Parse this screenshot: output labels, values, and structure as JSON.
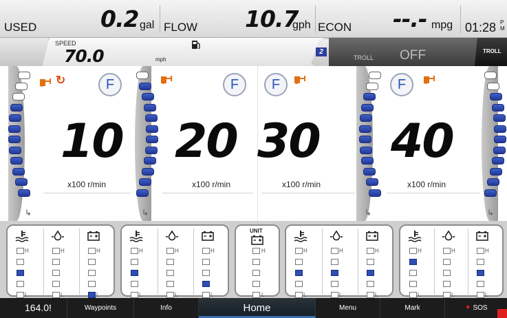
{
  "topbar": {
    "used_label": "USED",
    "used_value": "0.2",
    "used_unit": "gal",
    "flow_label": "FLOW",
    "flow_value": "10.7",
    "flow_unit": "gph",
    "econ_label": "ECON",
    "econ_value": "--.-",
    "econ_unit": "mpg",
    "clock": "01:28",
    "clock_suffix_top": "P",
    "clock_suffix_bottom": "M"
  },
  "speedbar": {
    "speed_label": "SPEED",
    "speed_value": "70.0",
    "speed_unit": "mph",
    "gear_number": "2",
    "troll_label": "TROLL",
    "troll_state": "OFF",
    "troll_button": "TROLL"
  },
  "engines": [
    {
      "rpm": "10",
      "unit": "x100 r/min",
      "badge": "F"
    },
    {
      "rpm": "20",
      "unit": "x100 r/min",
      "badge": "F"
    },
    {
      "rpm": "30",
      "unit": "x100 r/min",
      "badge": "F"
    },
    {
      "rpm": "40",
      "unit": "x100 r/min",
      "badge": "F"
    }
  ],
  "gauges": {
    "high_label": "H",
    "low_label": "L",
    "unit_label": "UNIT",
    "groups": [
      {
        "temp_level": 3,
        "oil_level": 0,
        "batt_level": 5
      },
      {
        "temp_level": 3,
        "oil_level": 0,
        "batt_level": 4
      },
      {
        "unit_level": 0
      },
      {
        "temp_level": 3,
        "oil_level": 3,
        "batt_level": 3
      },
      {
        "temp_level": 2,
        "oil_level": 0,
        "batt_level": 3
      }
    ]
  },
  "nav": {
    "left_value": "164.0!",
    "waypoints": "Waypoints",
    "info": "Info",
    "home": "Home",
    "menu": "Menu",
    "mark": "Mark",
    "sos": "SOS"
  },
  "colors": {
    "accent_blue": "#2d4fb5",
    "alert_orange": "#e07010",
    "sos_red": "#e02020"
  }
}
